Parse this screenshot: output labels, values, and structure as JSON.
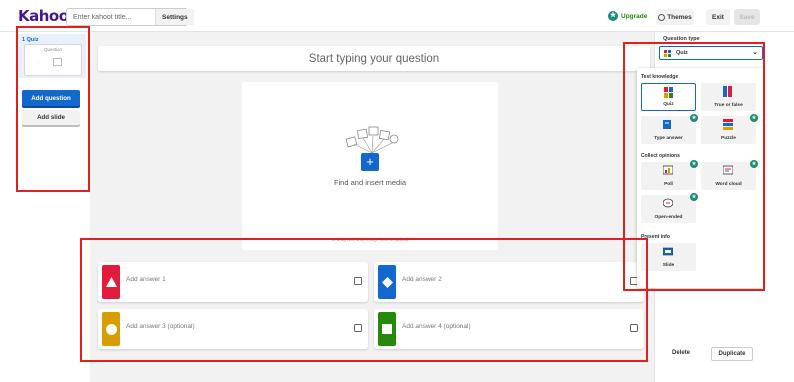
{
  "header": {
    "logo": "Kahoot!",
    "title_placeholder": "Enter kahoot title...",
    "settings_label": "Settings",
    "upgrade_label": "Upgrade",
    "themes_label": "Themes",
    "exit_label": "Exit",
    "save_label": "Save"
  },
  "sidebar": {
    "slide_label": "1 Quiz",
    "thumb_question": "Question",
    "add_question_label": "Add question",
    "add_slide_label": "Add slide"
  },
  "editor": {
    "question_placeholder": "Start typing your question",
    "media_label": "Find and insert media",
    "media_sub": "or drag and drop image here to upload",
    "answers": [
      {
        "placeholder": "Add answer 1",
        "color": "#e21b3c",
        "shape": "triangle"
      },
      {
        "placeholder": "Add answer 2",
        "color": "#1368ce",
        "shape": "diamond"
      },
      {
        "placeholder": "Add answer 3 (optional)",
        "color": "#d89e00",
        "shape": "circle"
      },
      {
        "placeholder": "Add answer 4 (optional)",
        "color": "#26890c",
        "shape": "square"
      }
    ]
  },
  "right_panel": {
    "question_type_label": "Question type",
    "selected_type": "Quiz",
    "groups": {
      "test_knowledge": "Test knowledge",
      "collect_opinions": "Collect opinions",
      "present_info": "Present info"
    },
    "options": {
      "quiz": "Quiz",
      "true_false": "True or false",
      "type_answer": "Type answer",
      "puzzle": "Puzzle",
      "poll": "Poll",
      "word_cloud": "Word cloud",
      "open_ended": "Open-ended",
      "slide": "Slide"
    },
    "delete_label": "Delete",
    "duplicate_label": "Duplicate"
  },
  "colors": {
    "brand": "#46178f",
    "primary": "#1368ce",
    "annotation": "#e02020"
  }
}
